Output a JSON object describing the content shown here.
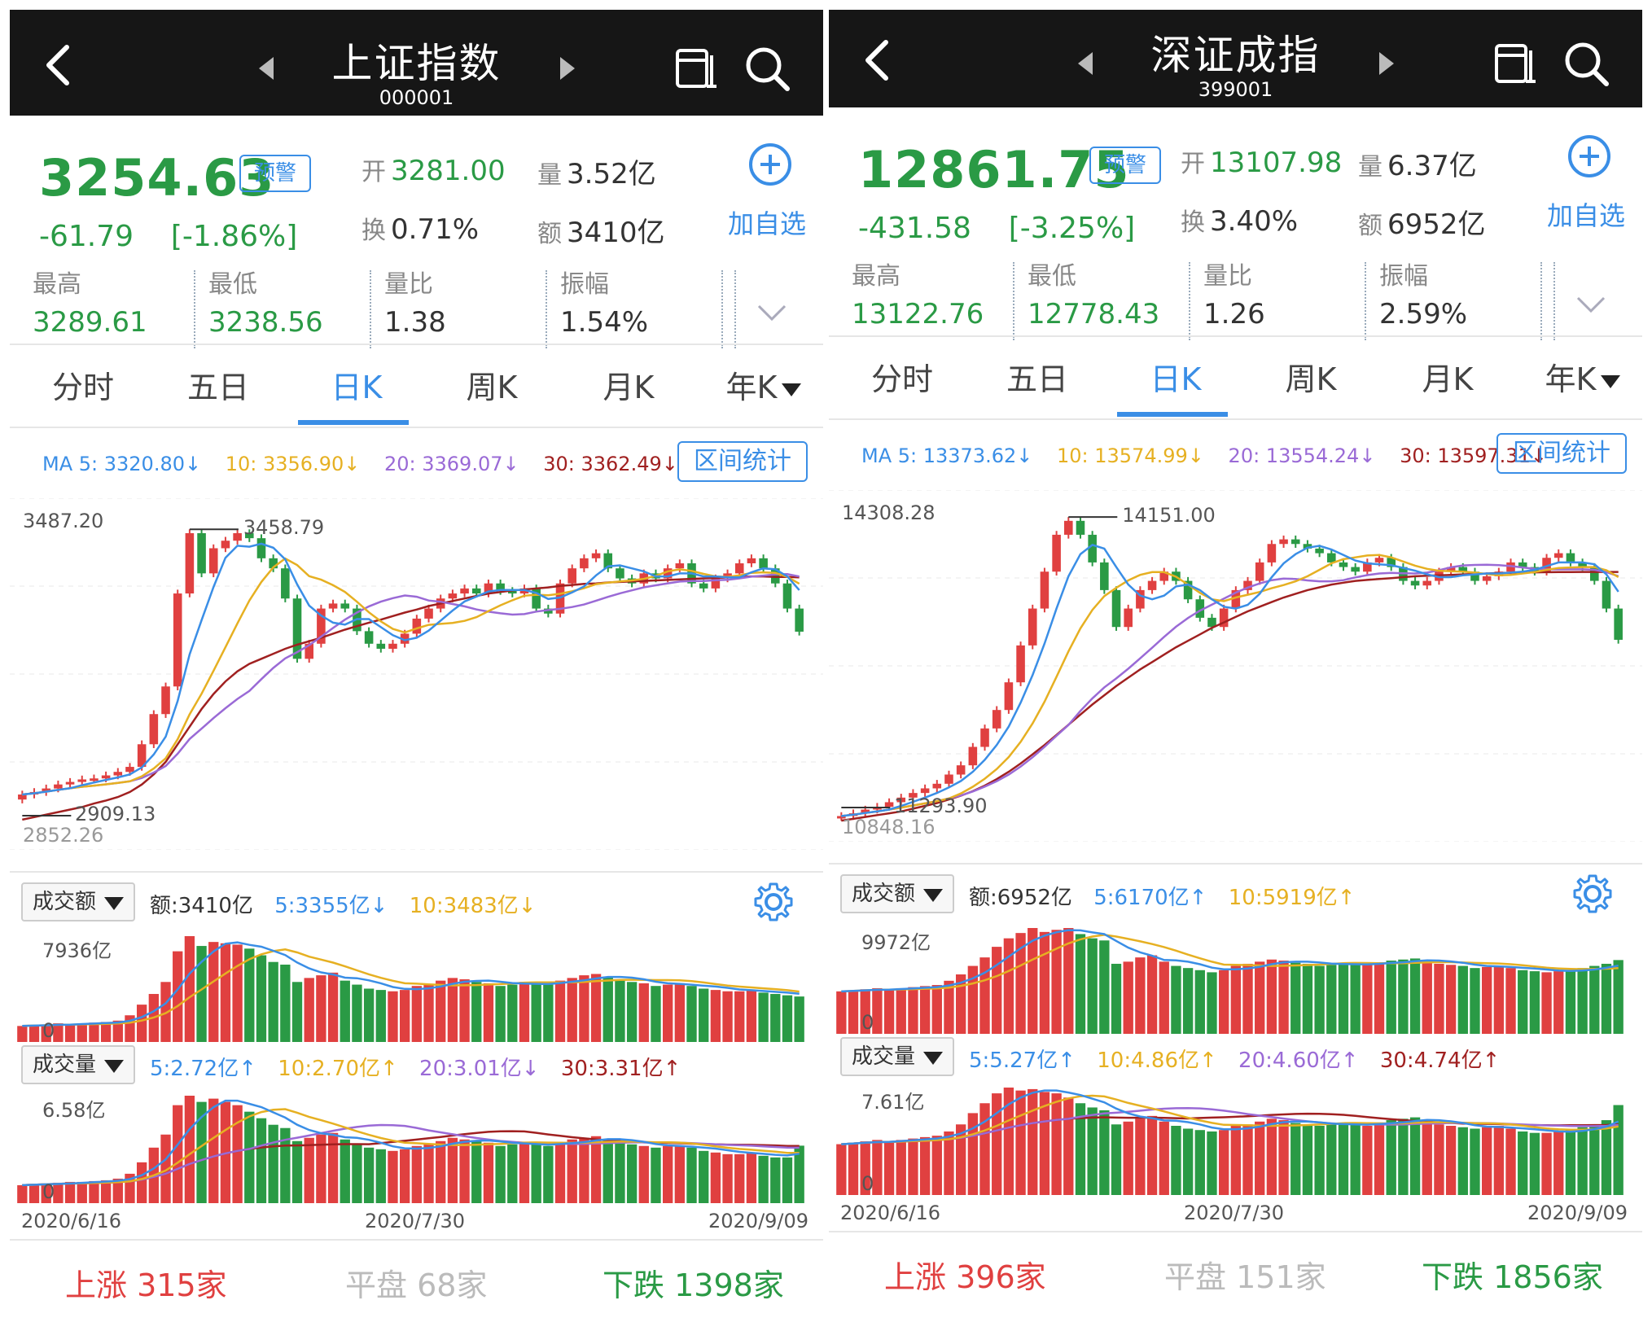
{
  "panels": [
    {
      "title": "上证指数",
      "code": "000001",
      "price": "3254.63",
      "alert": "预警",
      "change": "-61.79",
      "change_pct": "[-1.86%]",
      "open_label": "开",
      "open": "3281.00",
      "vol_label": "量",
      "vol": "3.52亿",
      "turnover_label": "换",
      "turnover": "0.71%",
      "amount_label": "额",
      "amount": "3410亿",
      "add_label": "加自选",
      "stats": [
        {
          "label": "最高",
          "value": "3289.61"
        },
        {
          "label": "最低",
          "value": "3238.56"
        },
        {
          "label": "量比",
          "value": "1.38"
        },
        {
          "label": "振幅",
          "value": "1.54%"
        }
      ],
      "tabs": [
        "分时",
        "五日",
        "日K",
        "周K",
        "月K",
        "年K"
      ],
      "active_tab": 2,
      "ma": {
        "ma5": "MA 5: 3320.80↓",
        "ma10": "10: 3356.90↓",
        "ma20": "20: 3369.07↓",
        "ma30": "30: 3362.49↓"
      },
      "range_btn": "区间统计",
      "price_top": "3487.20",
      "price_high_mark": "3458.79",
      "price_low_mark": "2909.13",
      "price_bottom": "2852.26",
      "amount_dd": "成交额",
      "amount_legend": {
        "cur": "额:3410亿",
        "m5": "5:3355亿↓",
        "m10": "10:3483亿↓"
      },
      "amount_max": "7936亿",
      "zero": "0",
      "volume_dd": "成交量",
      "volume_legend": {
        "m5": "5:2.72亿↑",
        "m10": "10:2.70亿↑",
        "m20": "20:3.01亿↓",
        "m30": "30:3.31亿↑"
      },
      "volume_max": "6.58亿",
      "dates": [
        "2020/6/16",
        "2020/7/30",
        "2020/9/09"
      ],
      "up": "上涨",
      "up_count": "315家",
      "flat": "平盘",
      "flat_count": "68家",
      "down": "下跌",
      "down_count": "1398家"
    },
    {
      "title": "深证成指",
      "code": "399001",
      "price": "12861.75",
      "alert": "预警",
      "change": "-431.58",
      "change_pct": "[-3.25%]",
      "open_label": "开",
      "open": "13107.98",
      "vol_label": "量",
      "vol": "6.37亿",
      "turnover_label": "换",
      "turnover": "3.40%",
      "amount_label": "额",
      "amount": "6952亿",
      "add_label": "加自选",
      "stats": [
        {
          "label": "最高",
          "value": "13122.76"
        },
        {
          "label": "最低",
          "value": "12778.43"
        },
        {
          "label": "量比",
          "value": "1.26"
        },
        {
          "label": "振幅",
          "value": "2.59%"
        }
      ],
      "tabs": [
        "分时",
        "五日",
        "日K",
        "周K",
        "月K",
        "年K"
      ],
      "active_tab": 2,
      "ma": {
        "ma5": "MA 5: 13373.62↓",
        "ma10": "10: 13574.99↓",
        "ma20": "20: 13554.24↓",
        "ma30": "30: 13597.31↓"
      },
      "range_btn": "区间统计",
      "price_top": "14308.28",
      "price_high_mark": "14151.00",
      "price_low_mark": "11293.90",
      "price_bottom": "10848.16",
      "amount_dd": "成交额",
      "amount_legend": {
        "cur": "额:6952亿",
        "m5": "5:6170亿↑",
        "m10": "10:5919亿↑"
      },
      "amount_max": "9972亿",
      "zero": "0",
      "volume_dd": "成交量",
      "volume_legend": {
        "m5": "5:5.27亿↑",
        "m10": "10:4.86亿↑",
        "m20": "20:4.60亿↑",
        "m30": "30:4.74亿↑"
      },
      "volume_max": "7.61亿",
      "dates": [
        "2020/6/16",
        "2020/7/30",
        "2020/9/09"
      ],
      "up": "上涨",
      "up_count": "396家",
      "flat": "平盘",
      "flat_count": "151家",
      "down": "下跌",
      "down_count": "1856家"
    }
  ],
  "colors": {
    "up": "#e04040",
    "down": "#2a9a45",
    "accent": "#3a8ee6",
    "ma5": "#3a8ee6",
    "ma10": "#e6b022",
    "ma20": "#9a6ad6",
    "ma30": "#a02020"
  },
  "chart_data": [
    {
      "type": "candlestick",
      "title": "上证指数 日K",
      "ylim": [
        2852.26,
        3487.2
      ],
      "close": [
        2930,
        2935,
        2942,
        2950,
        2955,
        2960,
        2962,
        2968,
        2975,
        2985,
        3030,
        3090,
        3145,
        3330,
        3450,
        3370,
        3420,
        3435,
        3450,
        3440,
        3400,
        3380,
        3320,
        3200,
        3230,
        3300,
        3310,
        3300,
        3255,
        3230,
        3220,
        3230,
        3250,
        3280,
        3300,
        3320,
        3330,
        3340,
        3330,
        3350,
        3335,
        3330,
        3340,
        3300,
        3290,
        3350,
        3380,
        3400,
        3410,
        3380,
        3360,
        3350,
        3370,
        3360,
        3380,
        3390,
        3350,
        3340,
        3360,
        3370,
        3390,
        3400,
        3380,
        3350,
        3300,
        3254
      ],
      "ma30": [
        2880,
        2885,
        2890,
        2895,
        2900,
        2905,
        2912,
        2918,
        2925,
        2935,
        2950,
        2970,
        2995,
        3030,
        3065,
        3100,
        3130,
        3155,
        3175,
        3190,
        3200,
        3210,
        3220,
        3228,
        3235,
        3242,
        3250,
        3258,
        3265,
        3272,
        3278,
        3285,
        3292,
        3298,
        3305,
        3310,
        3315,
        3320,
        3325,
        3330,
        3333,
        3336,
        3338,
        3340,
        3342,
        3345,
        3347,
        3349,
        3350,
        3352,
        3353,
        3354,
        3355,
        3356,
        3357,
        3358,
        3359,
        3360,
        3361,
        3362,
        3363,
        3364,
        3364,
        3363,
        3363,
        3362
      ],
      "amount": [
        1200,
        1250,
        1300,
        1400,
        1350,
        1400,
        1450,
        1500,
        1600,
        2000,
        2800,
        3600,
        4500,
        6800,
        7936,
        7200,
        7500,
        7400,
        7300,
        7000,
        6500,
        6000,
        5800,
        4500,
        4800,
        5000,
        5200,
        4600,
        4300,
        4000,
        3900,
        3800,
        3900,
        4200,
        4300,
        4600,
        4800,
        4700,
        4500,
        4400,
        4200,
        4300,
        4500,
        4400,
        4300,
        4600,
        4800,
        5000,
        5100,
        4900,
        4600,
        4500,
        4400,
        4200,
        4300,
        4400,
        4200,
        4000,
        3900,
        3800,
        3800,
        3900,
        3700,
        3600,
        3500,
        3410
      ],
      "volume": [
        1.1,
        1.15,
        1.2,
        1.25,
        1.3,
        1.3,
        1.35,
        1.4,
        1.5,
        1.8,
        2.5,
        3.4,
        4.2,
        6.0,
        6.58,
        6.2,
        6.4,
        6.2,
        6.0,
        5.6,
        5.2,
        4.8,
        4.6,
        3.8,
        4.0,
        4.2,
        4.3,
        3.9,
        3.6,
        3.4,
        3.3,
        3.2,
        3.3,
        3.5,
        3.6,
        3.8,
        4.0,
        3.9,
        3.8,
        3.7,
        3.5,
        3.6,
        3.7,
        3.6,
        3.5,
        3.7,
        3.9,
        4.0,
        4.1,
        3.9,
        3.7,
        3.6,
        3.5,
        3.4,
        3.5,
        3.5,
        3.4,
        3.2,
        3.1,
        3.0,
        3.0,
        3.1,
        2.9,
        2.8,
        2.8,
        3.52
      ]
    },
    {
      "type": "candlestick",
      "title": "深证成指 日K",
      "ylim": [
        10848.16,
        14308.28
      ],
      "close": [
        10950,
        10980,
        11020,
        11050,
        11100,
        11150,
        11200,
        11250,
        11300,
        11400,
        11500,
        11700,
        11900,
        12100,
        12400,
        12800,
        13200,
        13600,
        14000,
        14151,
        14000,
        13700,
        13400,
        13000,
        13200,
        13400,
        13500,
        13600,
        13500,
        13300,
        13100,
        13000,
        13200,
        13400,
        13500,
        13700,
        13900,
        13950,
        13900,
        13850,
        13800,
        13700,
        13650,
        13600,
        13700,
        13750,
        13650,
        13500,
        13450,
        13500,
        13600,
        13650,
        13600,
        13500,
        13550,
        13600,
        13700,
        13650,
        13600,
        13750,
        13800,
        13700,
        13650,
        13500,
        13200,
        12861
      ],
      "ma30": [
        10900,
        10920,
        10940,
        10960,
        10980,
        11000,
        11030,
        11060,
        11090,
        11130,
        11170,
        11220,
        11280,
        11350,
        11430,
        11520,
        11620,
        11720,
        11830,
        11940,
        12050,
        12160,
        12260,
        12360,
        12450,
        12540,
        12620,
        12700,
        12780,
        12850,
        12920,
        12990,
        13050,
        13110,
        13170,
        13220,
        13270,
        13320,
        13360,
        13400,
        13430,
        13460,
        13480,
        13500,
        13510,
        13520,
        13530,
        13540,
        13550,
        13555,
        13560,
        13565,
        13570,
        13575,
        13580,
        13585,
        13588,
        13590,
        13592,
        13594,
        13595,
        13596,
        13597,
        13597,
        13597,
        13597
      ],
      "amount": [
        4000,
        4100,
        4200,
        4300,
        4200,
        4300,
        4400,
        4500,
        4600,
        5000,
        5600,
        6400,
        7200,
        8200,
        9000,
        9500,
        9972,
        9600,
        9800,
        9972,
        9400,
        9000,
        8800,
        6600,
        6800,
        7200,
        7400,
        6800,
        6400,
        6200,
        6000,
        5800,
        6000,
        6400,
        6600,
        6800,
        7000,
        6900,
        6700,
        6600,
        6400,
        6500,
        6700,
        6600,
        6500,
        6700,
        6900,
        7000,
        7100,
        6900,
        6600,
        6500,
        6400,
        6200,
        6300,
        6400,
        6200,
        6000,
        5900,
        5800,
        5900,
        6000,
        6200,
        6400,
        6600,
        6952
      ],
      "volume": [
        3.6,
        3.7,
        3.8,
        3.9,
        3.8,
        3.9,
        4.0,
        4.1,
        4.2,
        4.5,
        5.0,
        5.8,
        6.5,
        7.2,
        7.61,
        7.4,
        7.5,
        7.3,
        7.2,
        6.9,
        6.5,
        6.2,
        6.0,
        5.0,
        5.2,
        5.4,
        5.6,
        5.2,
        4.9,
        4.7,
        4.6,
        4.5,
        4.6,
        4.9,
        5.0,
        5.2,
        5.4,
        5.3,
        5.1,
        5.0,
        4.9,
        5.0,
        5.1,
        5.0,
        4.9,
        5.1,
        5.3,
        5.4,
        5.5,
        5.3,
        5.0,
        4.9,
        4.8,
        4.7,
        4.8,
        4.9,
        4.7,
        4.5,
        4.4,
        4.4,
        4.5,
        4.6,
        4.8,
        5.0,
        5.3,
        6.37
      ]
    }
  ]
}
